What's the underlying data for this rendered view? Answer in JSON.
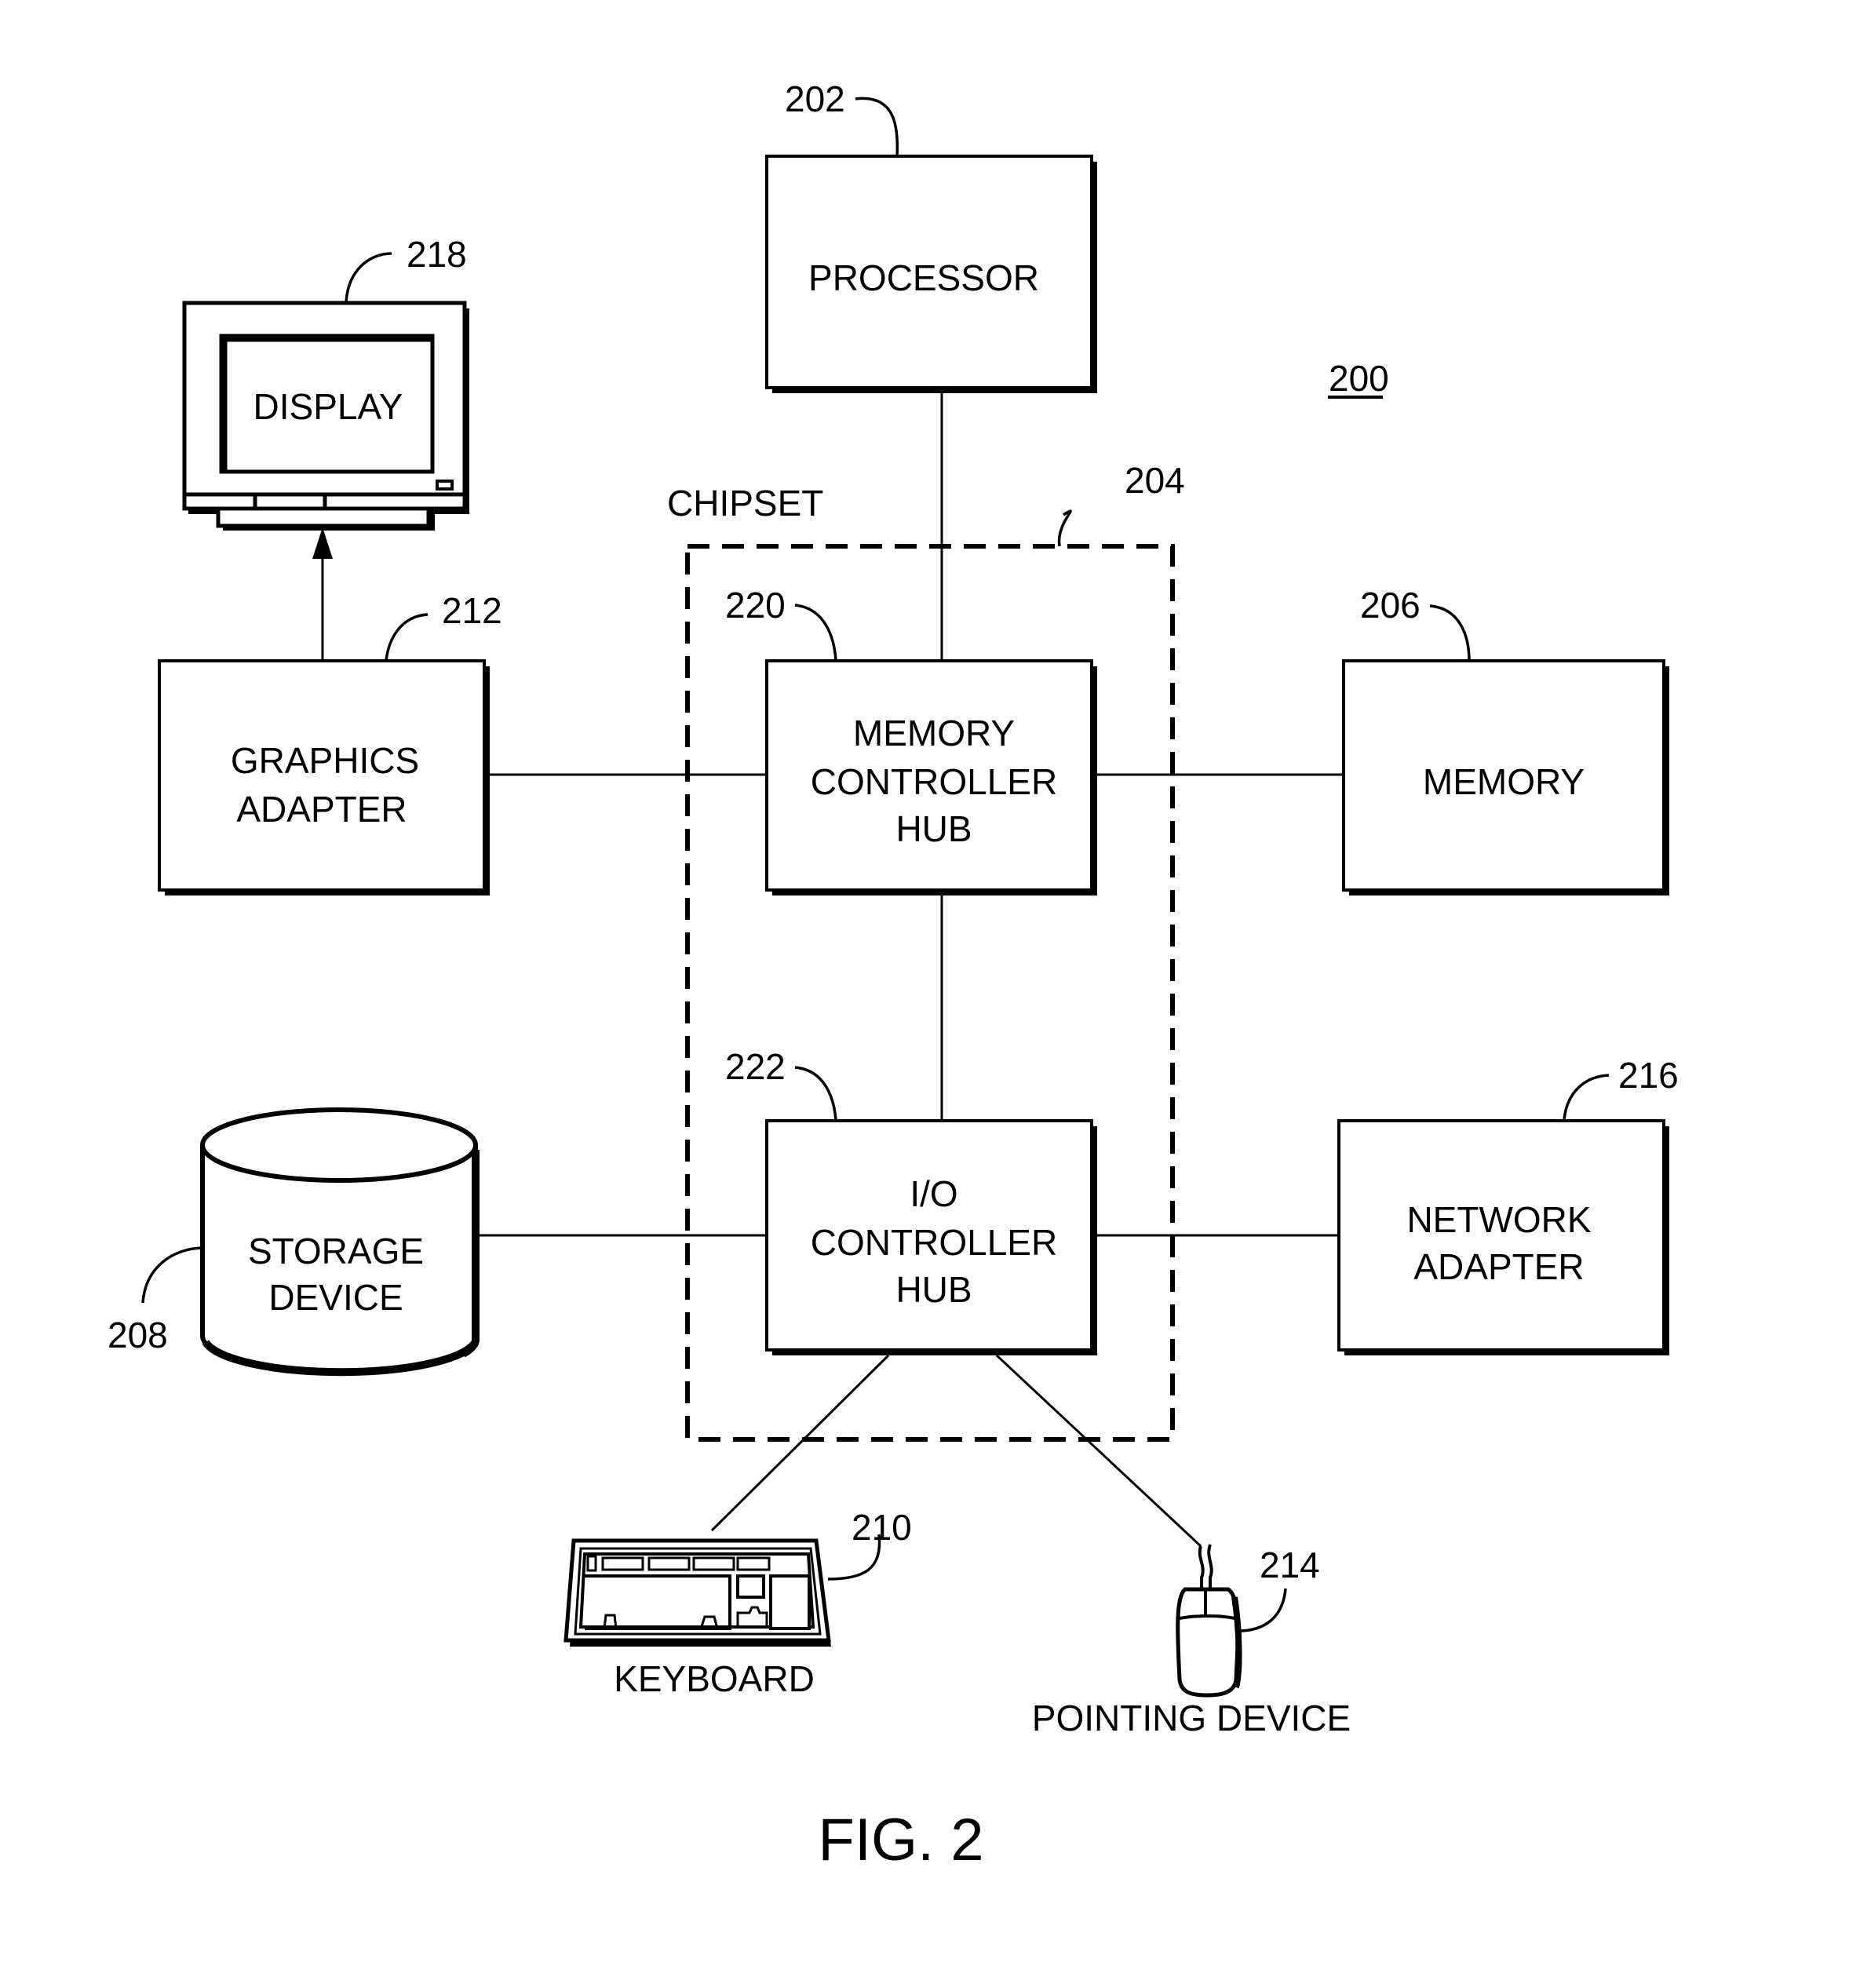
{
  "figure": {
    "number_label": "FIG. 2",
    "system_ref": "200"
  },
  "components": {
    "processor": {
      "label": [
        "PROCESSOR"
      ],
      "ref": "202"
    },
    "chipset": {
      "label": "CHIPSET",
      "ref": "204"
    },
    "memory_controller_hub": {
      "label": [
        "MEMORY",
        "CONTROLLER",
        "HUB"
      ],
      "ref": "220"
    },
    "io_controller_hub": {
      "label": [
        "I/O",
        "CONTROLLER",
        "HUB"
      ],
      "ref": "222"
    },
    "memory": {
      "label": [
        "MEMORY"
      ],
      "ref": "206"
    },
    "graphics_adapter": {
      "label": [
        "GRAPHICS",
        "ADAPTER"
      ],
      "ref": "212"
    },
    "display": {
      "label": "DISPLAY",
      "ref": "218"
    },
    "storage_device": {
      "label": [
        "STORAGE",
        "DEVICE"
      ],
      "ref": "208"
    },
    "network_adapter": {
      "label": [
        "NETWORK",
        "ADAPTER"
      ],
      "ref": "216"
    },
    "keyboard": {
      "label": "KEYBOARD",
      "ref": "210"
    },
    "pointing_device": {
      "label": "POINTING DEVICE",
      "ref": "214"
    }
  },
  "connections": [
    {
      "from": "processor",
      "to": "memory_controller_hub"
    },
    {
      "from": "memory_controller_hub",
      "to": "memory"
    },
    {
      "from": "memory_controller_hub",
      "to": "graphics_adapter"
    },
    {
      "from": "graphics_adapter",
      "to": "display",
      "directed": true
    },
    {
      "from": "memory_controller_hub",
      "to": "io_controller_hub"
    },
    {
      "from": "io_controller_hub",
      "to": "storage_device"
    },
    {
      "from": "io_controller_hub",
      "to": "network_adapter"
    },
    {
      "from": "io_controller_hub",
      "to": "keyboard"
    },
    {
      "from": "io_controller_hub",
      "to": "pointing_device"
    }
  ]
}
